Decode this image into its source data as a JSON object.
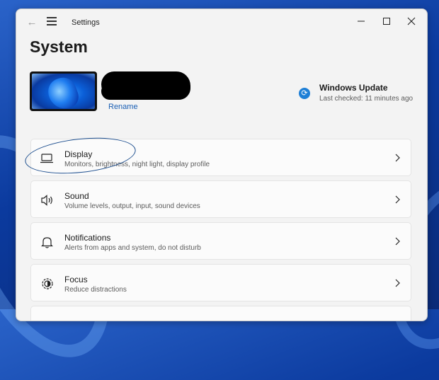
{
  "window": {
    "title": "Settings"
  },
  "page": {
    "title": "System"
  },
  "device": {
    "rename_label": "Rename"
  },
  "windows_update": {
    "title": "Windows Update",
    "subtitle": "Last checked: 11 minutes ago"
  },
  "cards": [
    {
      "title": "Display",
      "subtitle": "Monitors, brightness, night light, display profile",
      "icon": "monitor-icon"
    },
    {
      "title": "Sound",
      "subtitle": "Volume levels, output, input, sound devices",
      "icon": "speaker-icon"
    },
    {
      "title": "Notifications",
      "subtitle": "Alerts from apps and system, do not disturb",
      "icon": "bell-icon"
    },
    {
      "title": "Focus",
      "subtitle": "Reduce distractions",
      "icon": "focus-icon"
    }
  ],
  "colors": {
    "accent": "#1a5fb4",
    "update_icon": "#1e7fd6"
  }
}
